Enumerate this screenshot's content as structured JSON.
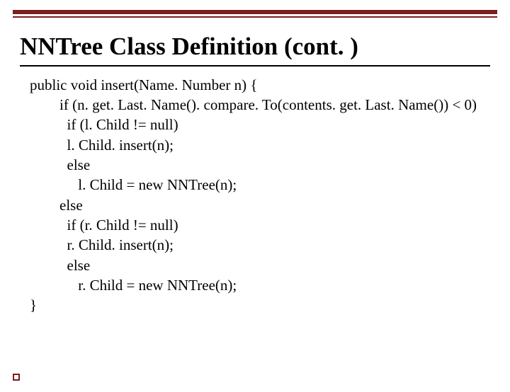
{
  "title": {
    "bold": "NNTree",
    "rest": " Class Definition (cont. )"
  },
  "code": {
    "l0": "public void insert(Name. Number n) {",
    "l1": "        if (n. get. Last. Name(). compare. To(contents. get. Last. Name()) < 0)",
    "l2": "          if (l. Child != null)",
    "l3": "          l. Child. insert(n);",
    "l4": "          else",
    "l5": "             l. Child = new NNTree(n);",
    "l6": "        else",
    "l7": "          if (r. Child != null)",
    "l8": "          r. Child. insert(n);",
    "l9": "          else",
    "l10": "             r. Child = new NNTree(n);",
    "l11": "}"
  }
}
